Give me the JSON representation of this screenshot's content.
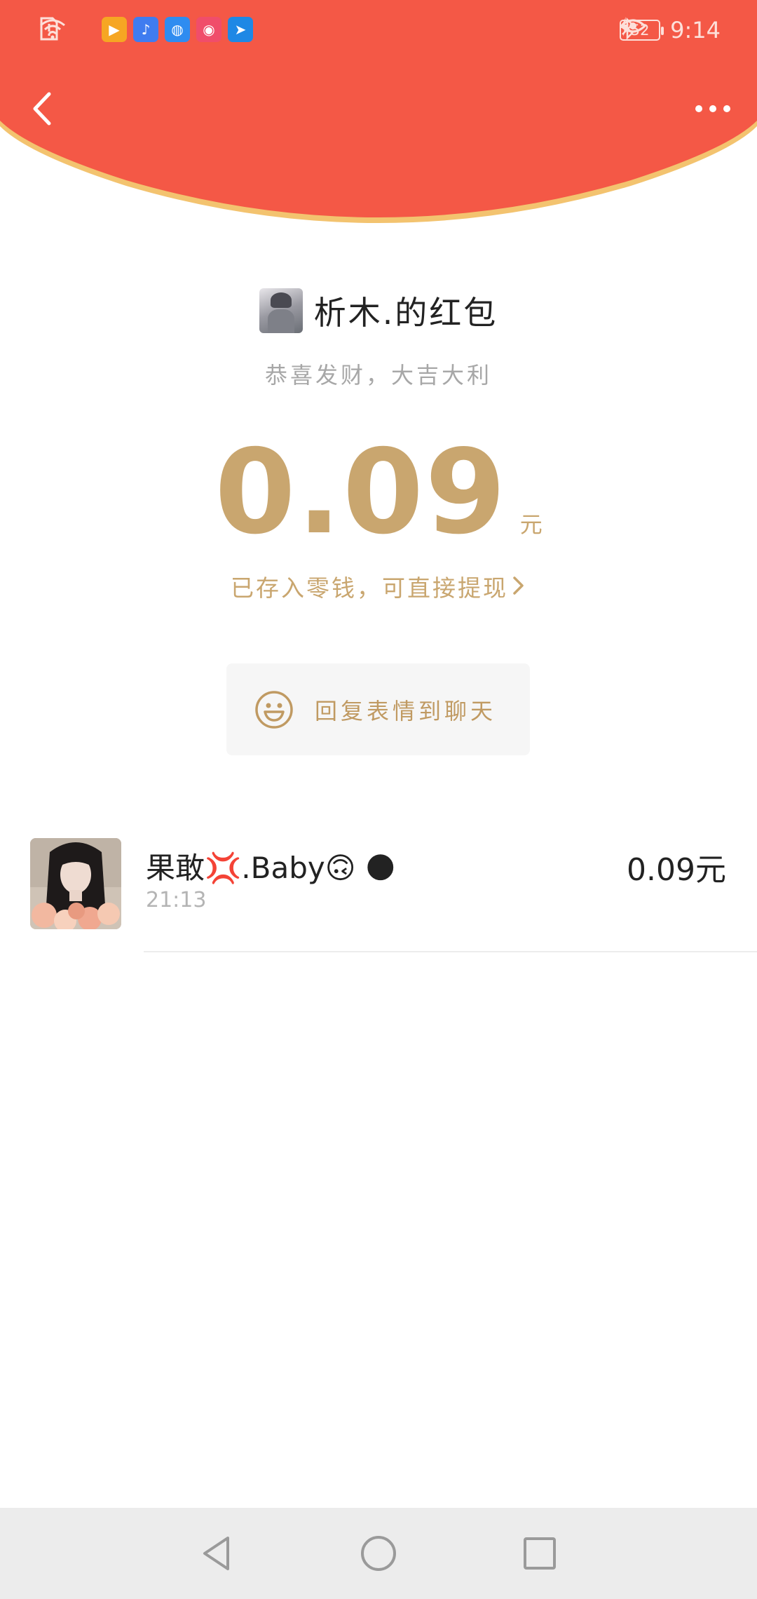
{
  "status_bar": {
    "time": "9:14",
    "battery": "52",
    "left_icons": [
      "sim-alert-icon",
      "wifi-icon",
      "video-app-icon",
      "music-app-icon",
      "browser-app-icon",
      "camera-app-icon",
      "feather-app-icon"
    ],
    "right_icons": [
      "eye-icon",
      "bluetooth-icon",
      "battery-icon",
      "charging-icon"
    ]
  },
  "header": {
    "back_icon": "chevron-left-icon",
    "more_icon": "more-dots-icon",
    "colors": {
      "header_bg": "#f45846",
      "header_rim": "#f3c36f",
      "gold": "#c9a66f"
    }
  },
  "packet": {
    "title": "析木.的红包",
    "greeting": "恭喜发财，大吉大利",
    "amount": "0.09",
    "unit": "元",
    "stored_text": "已存入零钱，可直接提现",
    "reply_label": "回复表情到聊天"
  },
  "receivers": [
    {
      "name": "果敢💢.Baby🙃 🌑",
      "time": "21:13",
      "amount": "0.09元"
    }
  ],
  "nav": [
    "back-triangle-icon",
    "home-circle-icon",
    "recents-square-icon"
  ]
}
